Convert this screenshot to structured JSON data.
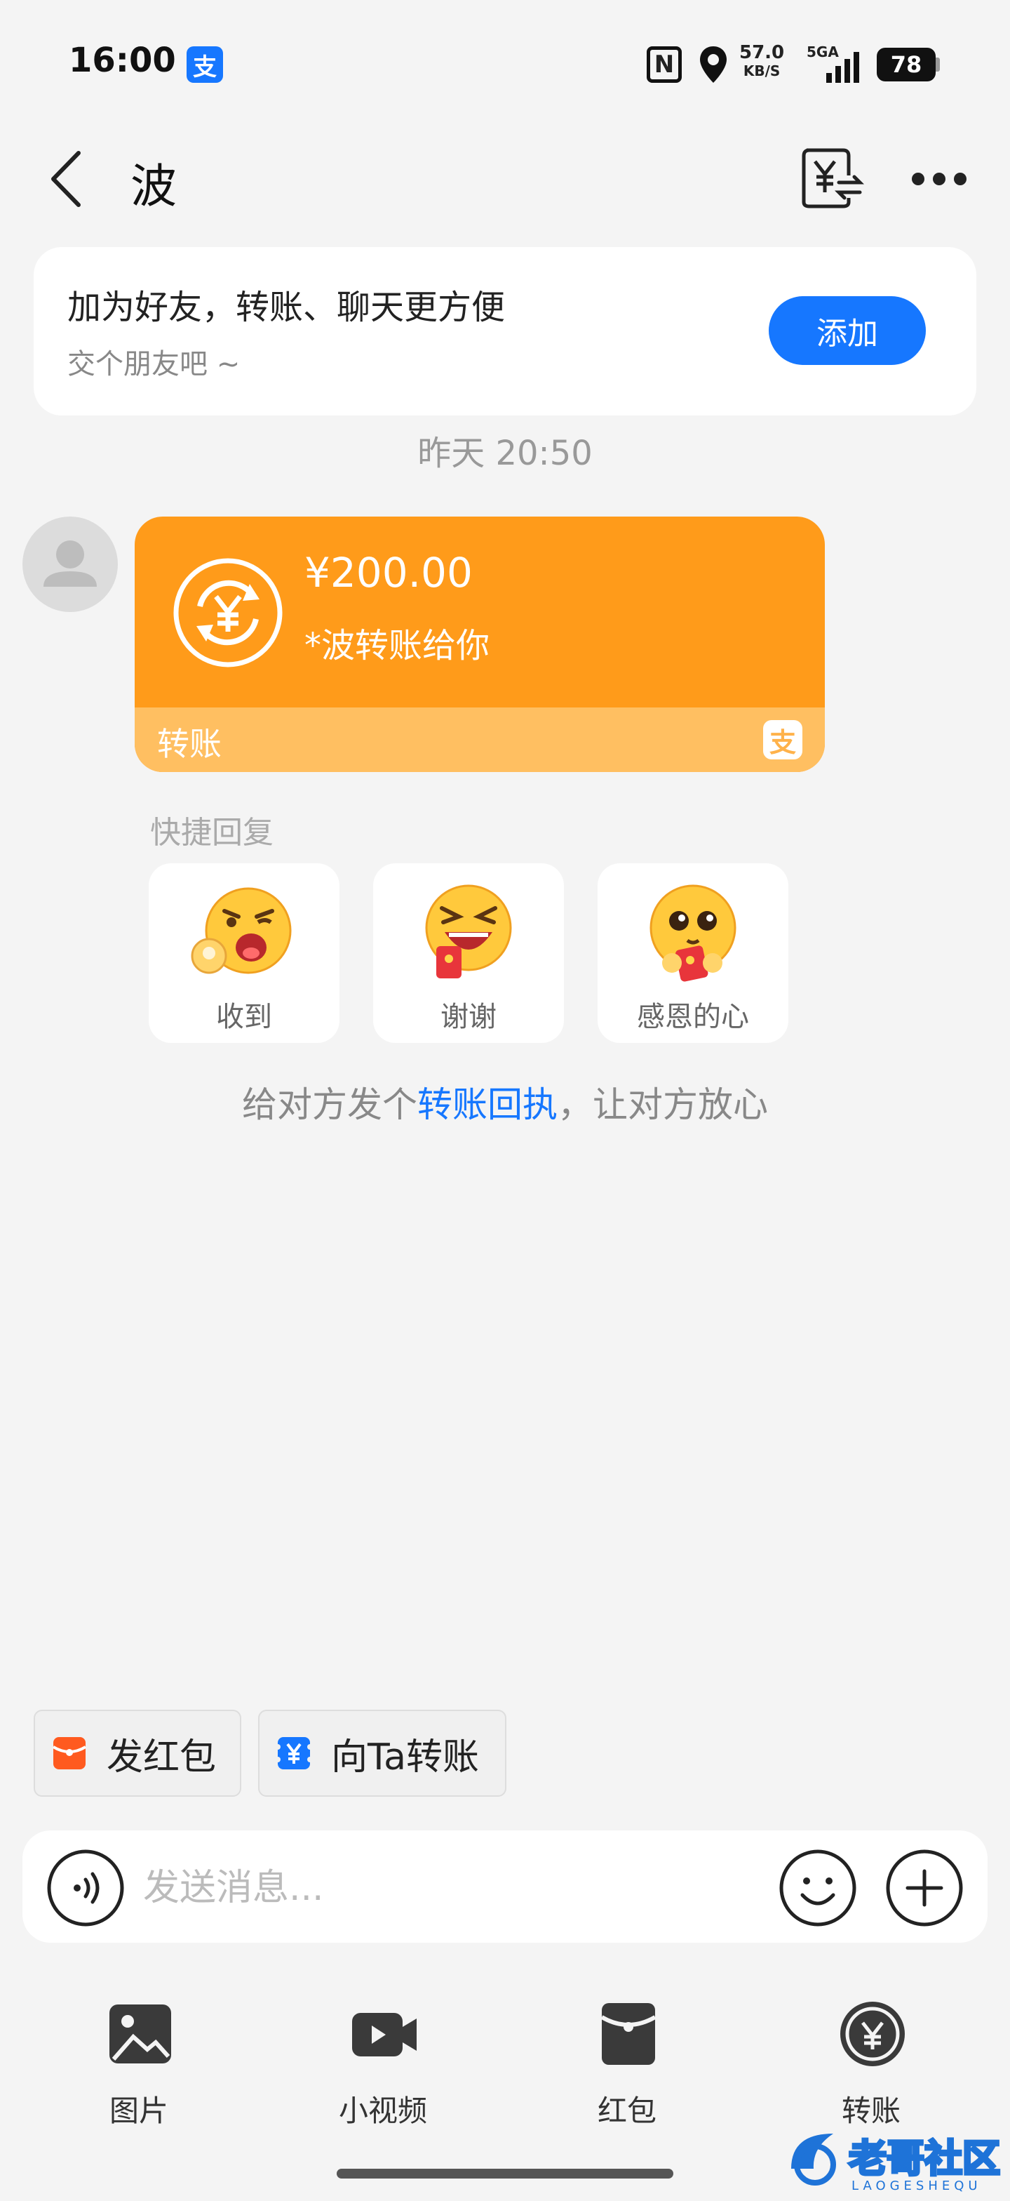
{
  "status_bar": {
    "time": "16:00",
    "alipay_badge": "支",
    "nfc": "N",
    "net_speed": "57.0",
    "net_speed_unit": "KB/S",
    "signal_label": "5GA",
    "battery": "78"
  },
  "header": {
    "title": "波"
  },
  "friend_banner": {
    "title": "加为好友，转账、聊天更方便",
    "subtitle": "交个朋友吧 ~",
    "add_label": "添加"
  },
  "timestamp": "昨天 20:50",
  "transfer_message": {
    "amount": "¥200.00",
    "note": "*波转账给你",
    "label": "转账",
    "badge": "支",
    "colors": {
      "card": "#ff9b1a",
      "card_footer": "#ffbf61"
    }
  },
  "quick_reply": {
    "title": "快捷回复",
    "items": [
      {
        "label": "收到",
        "icon": "ok-hand-emoji-icon"
      },
      {
        "label": "谢谢",
        "icon": "grinning-red-envelope-emoji-icon"
      },
      {
        "label": "感恩的心",
        "icon": "grateful-emoji-icon"
      }
    ]
  },
  "receipt_hint": {
    "prefix": "给对方发个",
    "link": "转账回执",
    "suffix": "，让对方放心"
  },
  "shortcuts": {
    "red_packet": "发红包",
    "transfer": "向Ta转账"
  },
  "input": {
    "placeholder": "发送消息..."
  },
  "toolbar": {
    "items": [
      {
        "label": "图片",
        "icon": "image-icon"
      },
      {
        "label": "小视频",
        "icon": "video-icon"
      },
      {
        "label": "红包",
        "icon": "red-packet-icon"
      },
      {
        "label": "转账",
        "icon": "transfer-icon"
      }
    ]
  },
  "watermark": {
    "text": "老哥社区",
    "subtext": "LAOGESHEQU"
  },
  "colors": {
    "accent": "#1677ff",
    "background": "#f4f4f4",
    "red_packet": "#ff5a1f"
  }
}
